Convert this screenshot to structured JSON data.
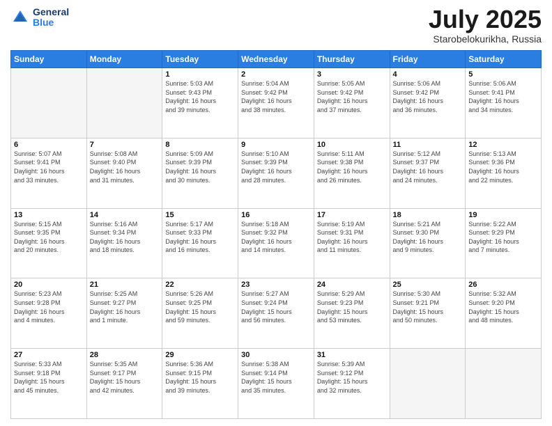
{
  "logo": {
    "general": "General",
    "blue": "Blue"
  },
  "title": "July 2025",
  "subtitle": "Starobelokurikha, Russia",
  "days_header": [
    "Sunday",
    "Monday",
    "Tuesday",
    "Wednesday",
    "Thursday",
    "Friday",
    "Saturday"
  ],
  "weeks": [
    [
      {
        "day": "",
        "info": ""
      },
      {
        "day": "",
        "info": ""
      },
      {
        "day": "1",
        "info": "Sunrise: 5:03 AM\nSunset: 9:43 PM\nDaylight: 16 hours\nand 39 minutes."
      },
      {
        "day": "2",
        "info": "Sunrise: 5:04 AM\nSunset: 9:42 PM\nDaylight: 16 hours\nand 38 minutes."
      },
      {
        "day": "3",
        "info": "Sunrise: 5:05 AM\nSunset: 9:42 PM\nDaylight: 16 hours\nand 37 minutes."
      },
      {
        "day": "4",
        "info": "Sunrise: 5:06 AM\nSunset: 9:42 PM\nDaylight: 16 hours\nand 36 minutes."
      },
      {
        "day": "5",
        "info": "Sunrise: 5:06 AM\nSunset: 9:41 PM\nDaylight: 16 hours\nand 34 minutes."
      }
    ],
    [
      {
        "day": "6",
        "info": "Sunrise: 5:07 AM\nSunset: 9:41 PM\nDaylight: 16 hours\nand 33 minutes."
      },
      {
        "day": "7",
        "info": "Sunrise: 5:08 AM\nSunset: 9:40 PM\nDaylight: 16 hours\nand 31 minutes."
      },
      {
        "day": "8",
        "info": "Sunrise: 5:09 AM\nSunset: 9:39 PM\nDaylight: 16 hours\nand 30 minutes."
      },
      {
        "day": "9",
        "info": "Sunrise: 5:10 AM\nSunset: 9:39 PM\nDaylight: 16 hours\nand 28 minutes."
      },
      {
        "day": "10",
        "info": "Sunrise: 5:11 AM\nSunset: 9:38 PM\nDaylight: 16 hours\nand 26 minutes."
      },
      {
        "day": "11",
        "info": "Sunrise: 5:12 AM\nSunset: 9:37 PM\nDaylight: 16 hours\nand 24 minutes."
      },
      {
        "day": "12",
        "info": "Sunrise: 5:13 AM\nSunset: 9:36 PM\nDaylight: 16 hours\nand 22 minutes."
      }
    ],
    [
      {
        "day": "13",
        "info": "Sunrise: 5:15 AM\nSunset: 9:35 PM\nDaylight: 16 hours\nand 20 minutes."
      },
      {
        "day": "14",
        "info": "Sunrise: 5:16 AM\nSunset: 9:34 PM\nDaylight: 16 hours\nand 18 minutes."
      },
      {
        "day": "15",
        "info": "Sunrise: 5:17 AM\nSunset: 9:33 PM\nDaylight: 16 hours\nand 16 minutes."
      },
      {
        "day": "16",
        "info": "Sunrise: 5:18 AM\nSunset: 9:32 PM\nDaylight: 16 hours\nand 14 minutes."
      },
      {
        "day": "17",
        "info": "Sunrise: 5:19 AM\nSunset: 9:31 PM\nDaylight: 16 hours\nand 11 minutes."
      },
      {
        "day": "18",
        "info": "Sunrise: 5:21 AM\nSunset: 9:30 PM\nDaylight: 16 hours\nand 9 minutes."
      },
      {
        "day": "19",
        "info": "Sunrise: 5:22 AM\nSunset: 9:29 PM\nDaylight: 16 hours\nand 7 minutes."
      }
    ],
    [
      {
        "day": "20",
        "info": "Sunrise: 5:23 AM\nSunset: 9:28 PM\nDaylight: 16 hours\nand 4 minutes."
      },
      {
        "day": "21",
        "info": "Sunrise: 5:25 AM\nSunset: 9:27 PM\nDaylight: 16 hours\nand 1 minute."
      },
      {
        "day": "22",
        "info": "Sunrise: 5:26 AM\nSunset: 9:25 PM\nDaylight: 15 hours\nand 59 minutes."
      },
      {
        "day": "23",
        "info": "Sunrise: 5:27 AM\nSunset: 9:24 PM\nDaylight: 15 hours\nand 56 minutes."
      },
      {
        "day": "24",
        "info": "Sunrise: 5:29 AM\nSunset: 9:23 PM\nDaylight: 15 hours\nand 53 minutes."
      },
      {
        "day": "25",
        "info": "Sunrise: 5:30 AM\nSunset: 9:21 PM\nDaylight: 15 hours\nand 50 minutes."
      },
      {
        "day": "26",
        "info": "Sunrise: 5:32 AM\nSunset: 9:20 PM\nDaylight: 15 hours\nand 48 minutes."
      }
    ],
    [
      {
        "day": "27",
        "info": "Sunrise: 5:33 AM\nSunset: 9:18 PM\nDaylight: 15 hours\nand 45 minutes."
      },
      {
        "day": "28",
        "info": "Sunrise: 5:35 AM\nSunset: 9:17 PM\nDaylight: 15 hours\nand 42 minutes."
      },
      {
        "day": "29",
        "info": "Sunrise: 5:36 AM\nSunset: 9:15 PM\nDaylight: 15 hours\nand 39 minutes."
      },
      {
        "day": "30",
        "info": "Sunrise: 5:38 AM\nSunset: 9:14 PM\nDaylight: 15 hours\nand 35 minutes."
      },
      {
        "day": "31",
        "info": "Sunrise: 5:39 AM\nSunset: 9:12 PM\nDaylight: 15 hours\nand 32 minutes."
      },
      {
        "day": "",
        "info": ""
      },
      {
        "day": "",
        "info": ""
      }
    ]
  ]
}
